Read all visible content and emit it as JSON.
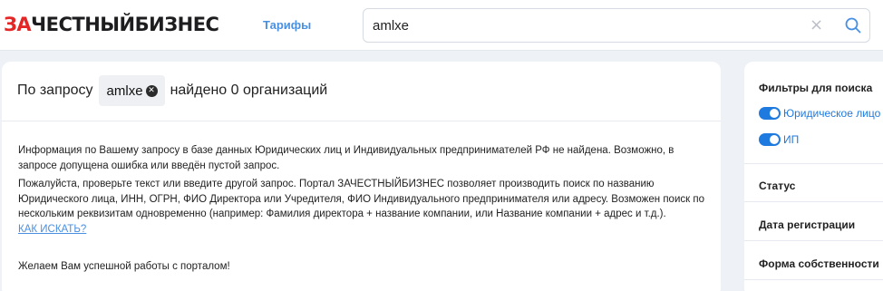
{
  "header": {
    "logo_red": "ЗА",
    "logo_dark": "ЧЕСТНЫЙБИЗНЕС",
    "nav_link": "Тарифы",
    "search_value": "amlxe",
    "search_clear": "×"
  },
  "result": {
    "prefix": "По запросу",
    "query": "amlxe",
    "suffix": "найдено 0 организаций"
  },
  "messages": {
    "not_found": "Информация по Вашему запросу в базе данных Юридических лиц и Индивидуальных предпринимателей РФ не найдена. Возможно, в запросе допущена ошибка или введён пустой запрос.",
    "advice": "Пожалуйста, проверьте текст или введите другой запрос. Портал ЗАЧЕСТНЫЙБИЗНЕС позволяет производить поиск по названию Юридического лица, ИНН, ОГРН, ФИО Директора или Учредителя, ФИО Индивидуального предпринимателя или адресу. Возможен поиск по нескольким реквизитам одновременно (например: Фамилия директора + название компании, или Название компании + адрес и т.д.).",
    "how_to_link": "КАК ИСКАТЬ?",
    "wish": "Желаем Вам успешной работы с порталом!"
  },
  "filters": {
    "title": "Фильтры для поиска",
    "toggles": [
      {
        "label": "Юридическое лицо",
        "on": true
      },
      {
        "label": "ИП",
        "on": true
      }
    ],
    "sections": [
      "Статус",
      "Дата регистрации",
      "Форма собственности"
    ]
  },
  "colors": {
    "accent": "#1f7ae0",
    "link": "#4a90e2",
    "logo_red": "#e32626",
    "background": "#eef1f6"
  },
  "icons": {
    "search": "search-icon",
    "clear": "clear-icon",
    "chip_remove": "close-icon"
  }
}
